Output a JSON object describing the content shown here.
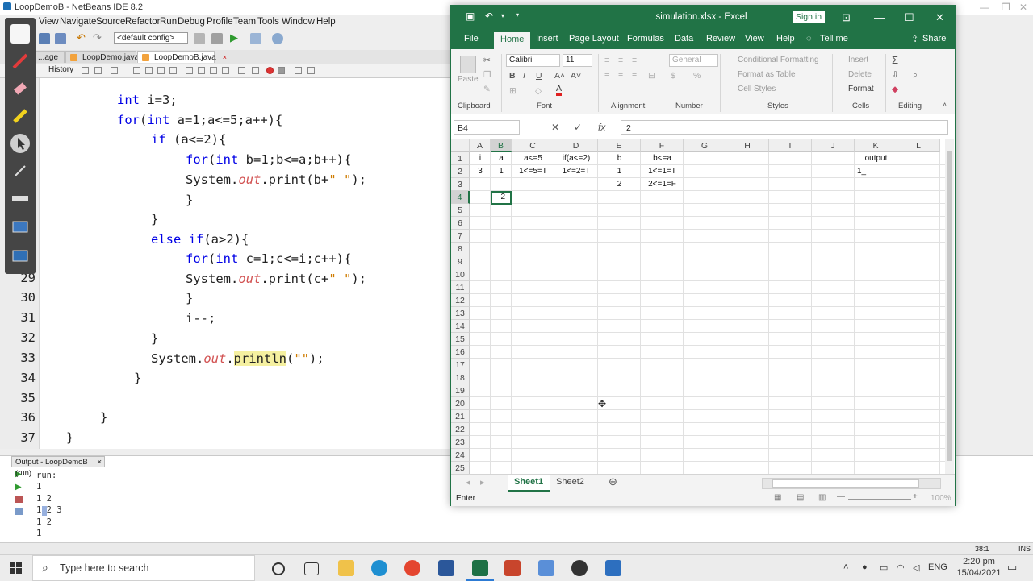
{
  "netbeans": {
    "title": "LoopDemoB - NetBeans IDE 8.2",
    "menu": [
      "File",
      "Edit",
      "View",
      "Navigate",
      "Source",
      "Refactor",
      "Run",
      "Debug",
      "Profile",
      "Team",
      "Tools",
      "Window",
      "Help"
    ],
    "config": "<default config>",
    "tabs": [
      {
        "label": "...age",
        "close": "×"
      },
      {
        "label": "LoopDemo.java",
        "close": "×"
      },
      {
        "label": "LoopDemoB.java",
        "close": "×"
      }
    ],
    "history_label": "History",
    "line_numbers": [
      "29",
      "30",
      "31",
      "32",
      "33",
      "34",
      "35",
      "36",
      "37"
    ],
    "output_tab": "Output - LoopDemoB (run)",
    "output_close": "×",
    "output_lines": [
      "run:",
      "1",
      "1 2",
      "1 2 3",
      "1 2",
      "1"
    ],
    "status_position": "38:1",
    "status_mode": "INS"
  },
  "excel": {
    "title": "simulation.xlsx - Excel",
    "sign_in": "Sign in",
    "tabs": [
      "File",
      "Home",
      "Insert",
      "Page Layout",
      "Formulas",
      "Data",
      "Review",
      "View",
      "Help",
      "Tell me"
    ],
    "share": "Share",
    "ribbon": {
      "paste": "Paste",
      "font_name": "Calibri",
      "font_size": "11",
      "number_format": "General",
      "conditional_formatting": "Conditional Formatting",
      "format_as_table": "Format as Table",
      "cell_styles": "Cell Styles",
      "insert": "Insert",
      "delete": "Delete",
      "format": "Format",
      "groups": [
        "Clipboard",
        "Font",
        "Alignment",
        "Number",
        "Styles",
        "Cells",
        "Editing"
      ]
    },
    "name_box": "B4",
    "formula_value": "2",
    "columns": [
      "A",
      "B",
      "C",
      "D",
      "E",
      "F",
      "G",
      "H",
      "I",
      "J",
      "K",
      "L"
    ],
    "rows": [
      "1",
      "2",
      "3",
      "4",
      "5",
      "6",
      "7",
      "8",
      "9",
      "10",
      "11",
      "12",
      "13",
      "14",
      "15",
      "16",
      "17",
      "18",
      "19",
      "20",
      "21",
      "22",
      "23",
      "24",
      "25"
    ],
    "cells": {
      "A1": "i",
      "B1": "a",
      "C1": "a<=5",
      "D1": "if(a<=2)",
      "E1": "b",
      "F1": "b<=a",
      "K1": "output",
      "A2": "3",
      "B2": "1",
      "C2": "1<=5=T",
      "D2": "1<=2=T",
      "E2": "1",
      "F2": "1<=1=T",
      "K2": "1_",
      "E3": "2",
      "F3": "2<=1=F",
      "B4": "2"
    },
    "sheets": [
      "Sheet1",
      "Sheet2"
    ],
    "status_mode": "Enter",
    "zoom": "100%"
  },
  "taskbar": {
    "search_placeholder": "Type here to search",
    "language": "ENG",
    "time": "2:20 pm",
    "date": "15/04/2021"
  }
}
